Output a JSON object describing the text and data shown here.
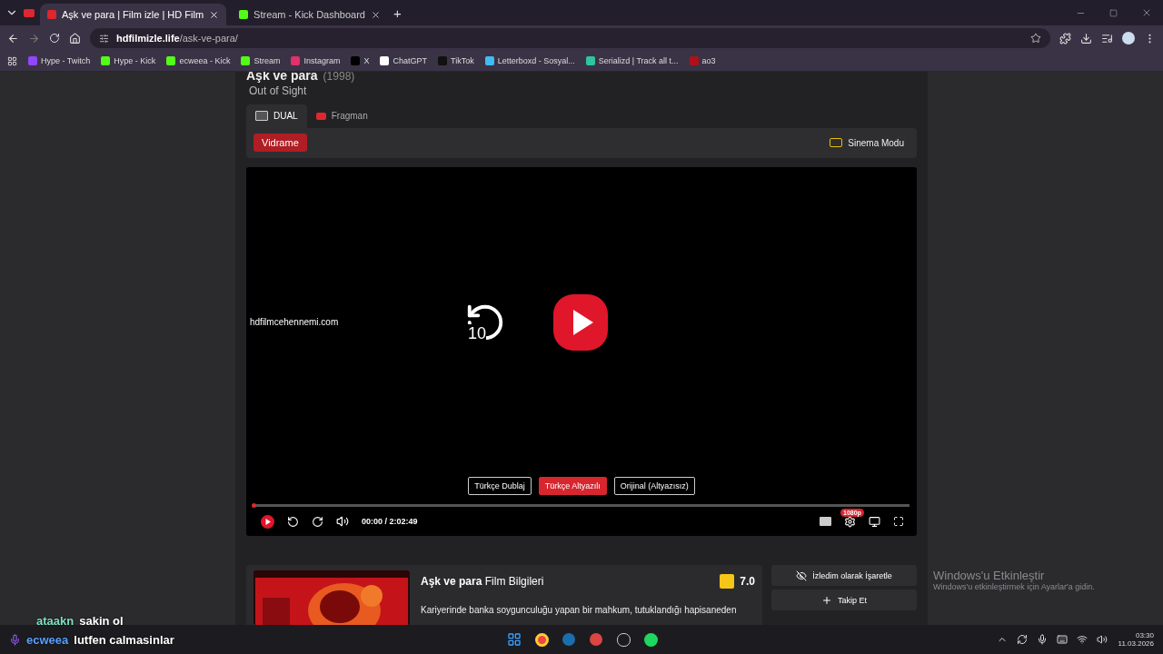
{
  "browser": {
    "tabs": [
      {
        "title": "Aşk ve para | Film izle | HD Film",
        "selected": true
      },
      {
        "title": "Stream - Kick Dashboard",
        "selected": false
      }
    ],
    "new_tab": "+",
    "address": {
      "host": "hdfilmizle.life",
      "path": "/ask-ve-para/"
    },
    "bookmarks": [
      {
        "label": "Hype - Twitch"
      },
      {
        "label": "Hype  - Kick"
      },
      {
        "label": "ecweea - Kick"
      },
      {
        "label": "Stream"
      },
      {
        "label": "Instagram"
      },
      {
        "label": "X"
      },
      {
        "label": "ChatGPT"
      },
      {
        "label": "TikTok"
      },
      {
        "label": "Letterboxd - Sosyal..."
      },
      {
        "label": "Serializd | Track all t..."
      },
      {
        "label": "ao3"
      }
    ]
  },
  "page": {
    "title": "Aşk ve para",
    "year": "(1998)",
    "original_title": "Out of Sight",
    "source_tabs": [
      {
        "label": "DUAL",
        "selected": true
      },
      {
        "label": "Fragman",
        "selected": false
      }
    ],
    "server_button": "Vidrame",
    "cinema_mode": "Sinema Modu",
    "player": {
      "watermark": "hdfilmcehennemi.com",
      "replay_label": "10",
      "languages": [
        {
          "label": "Türkçe Dublaj",
          "selected": false
        },
        {
          "label": "Türkçe Altyazılı",
          "selected": true
        },
        {
          "label": "Orijinal (Altyazısız)",
          "selected": false
        }
      ],
      "progress": {
        "level": 0
      },
      "current_time": "00:00",
      "separator": "/",
      "duration": "2:02:49",
      "quality": "1080p"
    },
    "info": {
      "heading": "**Aşk ve para** Film Bilgileri",
      "rating": "7.0",
      "description": "Kariyerinde banka soygunculuğu yapan bir mahkum, tutuklandığı hapisaneden"
    },
    "actions": [
      {
        "label": "İzledim olarak İşaretle"
      },
      {
        "label": "Takip Et"
      }
    ]
  },
  "chat": [
    {
      "user": "ataakn",
      "message": "sakin ol",
      "color": "#7ee0c0",
      "kind": "plain"
    },
    {
      "user": "ecweea",
      "message": "lutfen calmasinlar",
      "color": "#5aa0ff",
      "kind": "mic"
    }
  ],
  "activation": {
    "title": "Windows'u Etkinleştir",
    "text": "Windows'u etkinleştirmek için Ayarlar'a gidin."
  },
  "taskbar": {
    "time": "03:30",
    "date": "11.03.2026"
  }
}
